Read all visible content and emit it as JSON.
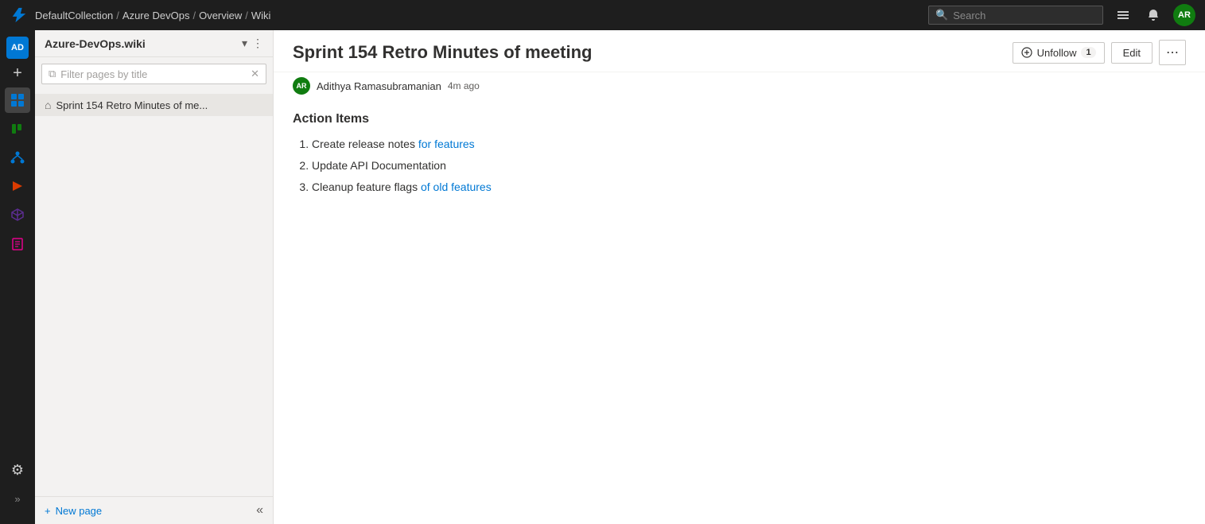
{
  "topnav": {
    "breadcrumbs": [
      {
        "label": "DefaultCollection",
        "sep": false
      },
      {
        "label": "Azure DevOps",
        "sep": true
      },
      {
        "label": "Overview",
        "sep": true
      },
      {
        "label": "Wiki",
        "sep": true
      }
    ],
    "search_placeholder": "Search",
    "avatar_initials": "AR"
  },
  "activitybar": {
    "logo_initials": "AD",
    "add_label": "+",
    "settings_icon": "⚙",
    "collapse_label": "»"
  },
  "sidebar": {
    "wiki_name": "Azure-DevOps.wiki",
    "filter_placeholder": "Filter pages by title",
    "tree_item": "Sprint 154 Retro Minutes of me...",
    "new_page_label": "New page",
    "collapse_icon": "«"
  },
  "content": {
    "page_title": "Sprint 154 Retro Minutes of meeting",
    "author_initials": "AR",
    "author_name": "Adithya Ramasubramanian",
    "time_ago": "4m ago",
    "unfollow_label": "Unfollow",
    "follow_count": "1",
    "edit_label": "Edit",
    "section_heading": "Action Items",
    "action_items": [
      {
        "text_before": "Create release notes ",
        "link": "for features",
        "text_after": ""
      },
      {
        "text_before": "Update API Documentation",
        "link": "",
        "text_after": ""
      },
      {
        "text_before": "Cleanup feature flags ",
        "link": "of old features",
        "text_after": ""
      }
    ]
  }
}
